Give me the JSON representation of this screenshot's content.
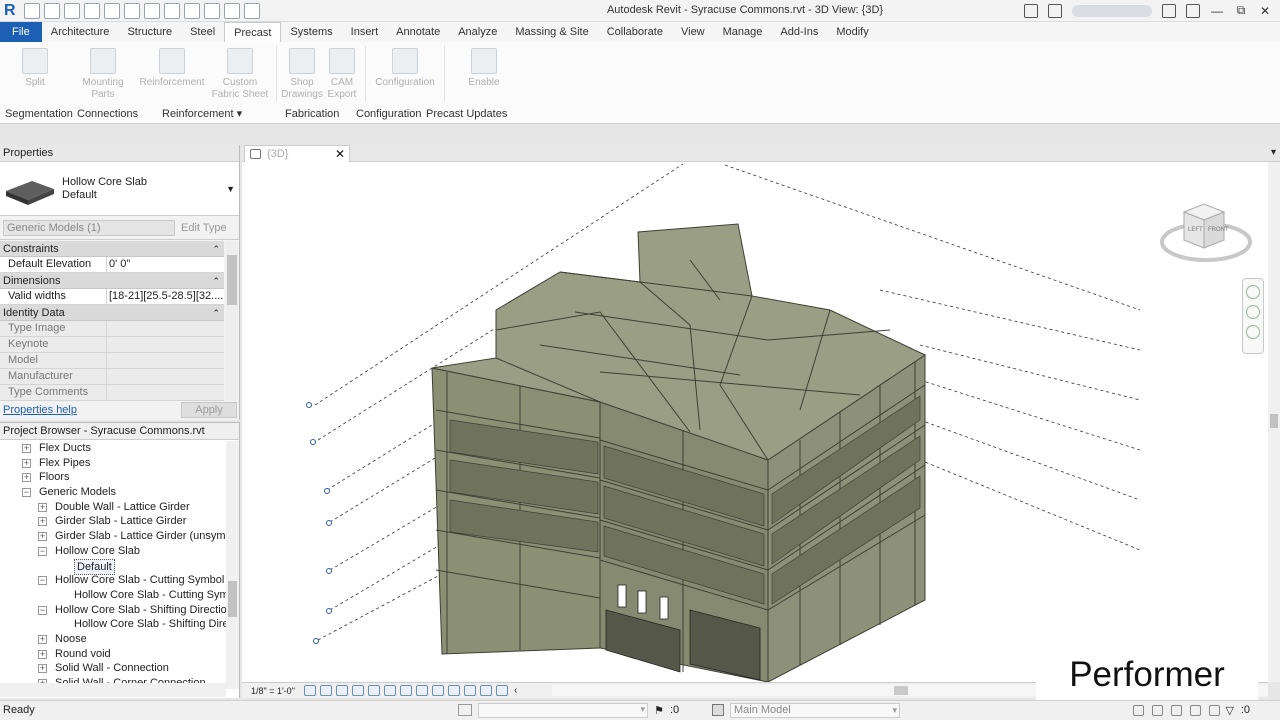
{
  "titlebar": {
    "app_logo": "R",
    "title": "Autodesk Revit - Syracuse Commons.rvt - 3D View: {3D}",
    "icons": [
      "open-icon",
      "save-icon",
      "sync-icon",
      "undo-icon",
      "redo-icon",
      "print-icon",
      "measure-icon",
      "text-icon",
      "3d-view-icon",
      "section-icon",
      "close-hidden-icon",
      "switch-windows-icon"
    ],
    "right_icons": [
      "binoculars-icon",
      "user-icon",
      "cart-icon",
      "help-icon"
    ],
    "window_buttons": [
      "—",
      "⧉",
      "✕"
    ]
  },
  "tabs": [
    "File",
    "Architecture",
    "Structure",
    "Steel",
    "Precast",
    "Systems",
    "Insert",
    "Annotate",
    "Analyze",
    "Massing & Site",
    "Collaborate",
    "View",
    "Manage",
    "Add-Ins",
    "Modify"
  ],
  "active_tab": "Precast",
  "ribbon": {
    "tools": [
      {
        "label": "Split",
        "label2": ""
      },
      {
        "label": "Mounting",
        "label2": "Parts"
      },
      {
        "label": "Reinforcement",
        "label2": ""
      },
      {
        "label": "Custom",
        "label2": "Fabric Sheet"
      },
      {
        "label": "Shop",
        "label2": "Drawings"
      },
      {
        "label": "CAM",
        "label2": "Export"
      },
      {
        "label": "Configuration",
        "label2": ""
      },
      {
        "label": "Enable",
        "label2": ""
      }
    ],
    "panels": [
      "Segmentation",
      "Connections",
      "Reinforcement ▾",
      "Fabrication",
      "Configuration",
      "Precast Updates"
    ]
  },
  "properties": {
    "title": "Properties",
    "type_name": "Hollow Core Slab",
    "type_sub": "Default",
    "instance_filter": "Generic Models (1)",
    "edit_type": "Edit Type",
    "groups": [
      {
        "name": "Constraints",
        "rows": [
          {
            "k": "Default Elevation",
            "v": "0'  0\""
          }
        ]
      },
      {
        "name": "Dimensions",
        "rows": [
          {
            "k": "Valid widths",
            "v": "[18-21][25.5-28.5][32...."
          }
        ]
      },
      {
        "name": "Identity Data",
        "rows": [
          {
            "k": "Type Image",
            "v": ""
          },
          {
            "k": "Keynote",
            "v": ""
          },
          {
            "k": "Model",
            "v": ""
          },
          {
            "k": "Manufacturer",
            "v": ""
          },
          {
            "k": "Type Comments",
            "v": ""
          }
        ]
      }
    ],
    "help": "Properties help",
    "apply": "Apply"
  },
  "browser": {
    "title": "Project Browser - Syracuse Commons.rvt",
    "nodes": [
      {
        "label": "Flex Ducts",
        "level": 1,
        "pm": "+"
      },
      {
        "label": "Flex Pipes",
        "level": 1,
        "pm": "+"
      },
      {
        "label": "Floors",
        "level": 1,
        "pm": "+"
      },
      {
        "label": "Generic Models",
        "level": 1,
        "pm": "−"
      },
      {
        "label": "Double Wall - Lattice Girder",
        "level": 2,
        "pm": "+"
      },
      {
        "label": "Girder Slab - Lattice Girder",
        "level": 2,
        "pm": "+"
      },
      {
        "label": "Girder Slab - Lattice Girder (unsymme",
        "level": 2,
        "pm": "+"
      },
      {
        "label": "Hollow Core Slab",
        "level": 2,
        "pm": "−"
      },
      {
        "label": "Default",
        "level": 3,
        "pm": "",
        "selected": true
      },
      {
        "label": "Hollow Core Slab - Cutting Symbol",
        "level": 2,
        "pm": "−"
      },
      {
        "label": "Hollow Core Slab - Cutting Symbo",
        "level": 3,
        "pm": ""
      },
      {
        "label": "Hollow Core Slab - Shifting Direction",
        "level": 2,
        "pm": "−"
      },
      {
        "label": "Hollow Core Slab - Shifting Direct",
        "level": 3,
        "pm": ""
      },
      {
        "label": "Noose",
        "level": 2,
        "pm": "+"
      },
      {
        "label": "Round void",
        "level": 2,
        "pm": "+"
      },
      {
        "label": "Solid Wall - Connection",
        "level": 2,
        "pm": "+"
      },
      {
        "label": "Solid Wall - Corner Connection",
        "level": 2,
        "pm": "+"
      }
    ]
  },
  "view": {
    "tab_label": "{3D}",
    "close": "✕",
    "viewcube": {
      "left": "LEFT",
      "front": "FRONT"
    },
    "scale": "1/8\" = 1'-0\""
  },
  "status": {
    "ready": "Ready",
    "sync_count": ":0",
    "design_option": "Main Model",
    "filter_count": ":0"
  },
  "watermark": "Performer",
  "colors": {
    "file_tab": "#1d5fb5",
    "building": "#8f9378",
    "roof": "#9a9e84"
  }
}
